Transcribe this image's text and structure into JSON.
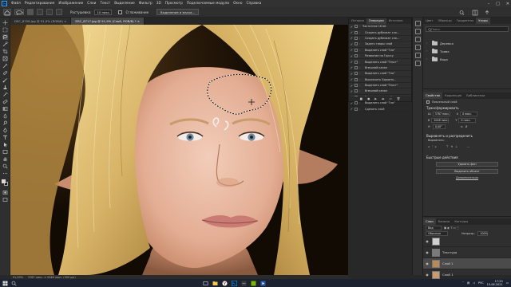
{
  "app": {
    "logo_text": "Ps"
  },
  "menubar": {
    "items": [
      "Файл",
      "Редактирование",
      "Изображение",
      "Слои",
      "Текст",
      "Выделение",
      "Фильтр",
      "3D",
      "Просмотр",
      "Подключаемые модули",
      "Окно",
      "Справка"
    ]
  },
  "options": {
    "feather_label": "Растушевка:",
    "feather_value": "10 пикс.",
    "antialias_label": "Сглаживание",
    "select_mask_button": "Выделение и маска..."
  },
  "tabs": [
    {
      "label": "DSC_8706.jpg @ 91,9% (RGB/8) ×",
      "active": false
    },
    {
      "label": "DSC_8717.jpg @ 91,9% (Слой, RGB/8) * ×",
      "active": true
    }
  ],
  "status": {
    "zoom": "91,59%",
    "doc_info": "3787 пикс. × 2048 пикс. (300 ppi)"
  },
  "history_panel": {
    "tabs": [
      "История",
      "Операции",
      "Источник"
    ],
    "active_tab": "Операции",
    "items": [
      {
        "label": "Частотное 16 bit",
        "checked": true,
        "folder": true
      },
      {
        "label": "Создать дубликат сло...",
        "checked": true,
        "folder": false
      },
      {
        "label": "Создать дубликат сло...",
        "checked": true,
        "folder": false
      },
      {
        "label": "Задать тиары слой",
        "checked": true,
        "folder": false
      },
      {
        "label": "Выделить слой \"Гло\"",
        "checked": true,
        "folder": false
      },
      {
        "label": "Размытие по Гауссу",
        "checked": true,
        "folder": false
      },
      {
        "label": "Выделить слой \"Текст\"",
        "checked": true,
        "folder": false
      },
      {
        "label": "Внешний канал",
        "checked": true,
        "folder": false
      },
      {
        "label": "Выделить слой \"Гло\"",
        "checked": true,
        "folder": false
      },
      {
        "label": "Выключить Удалить...",
        "checked": true,
        "folder": false
      },
      {
        "label": "Выделить слой \"Текст\"",
        "checked": true,
        "folder": false
      },
      {
        "label": "Внешний канал",
        "checked": true,
        "folder": false
      },
      {
        "label": "Задать тиары слой",
        "checked": true,
        "folder": false
      },
      {
        "label": "Выделить слой \"Гло\"",
        "checked": true,
        "folder": false
      },
      {
        "label": "Сделать слой",
        "checked": true,
        "folder": false
      }
    ],
    "footer_icons": [
      "■",
      "●",
      "▶",
      "▬",
      "▭",
      "🗑"
    ]
  },
  "right_top": {
    "tabs": [
      "Цвет",
      "Образцы",
      "Градиенты",
      "Узоры"
    ],
    "active_tab": "Узоры",
    "search_placeholder": "Поиск",
    "folders": [
      "Деревья",
      "Трава",
      "Вода"
    ]
  },
  "properties": {
    "tabs": [
      "Свойства",
      "Коррекция",
      "Библиотеки"
    ],
    "active_tab": "Свойства",
    "layer_type": "Пиксельный слой",
    "transform_title": "Трансформировать",
    "w_label": "Ш",
    "w_value": "3787 пикс.",
    "h_label": "В",
    "h_value": "2048 пикс.",
    "x_label": "X",
    "x_value": "0 пикс.",
    "y_label": "Y",
    "y_value": "0 пикс.",
    "angle_value": "0,00°",
    "align_title": "Выровнять и распределить",
    "align_sub": "Выровнять:",
    "quick_title": "Быстрые действия",
    "btn_remove_bg": "Удалить фон",
    "btn_select_subject": "Выделить объект",
    "more_link": "Дополнительно"
  },
  "layers_panel": {
    "tabs": [
      "Слои",
      "Каналы",
      "Контуры"
    ],
    "active_tab": "Слои",
    "kind_label": "Вид",
    "blend_mode": "Обычные",
    "opacity_label": "Непрозр.:",
    "opacity_value": "100%",
    "lock_label": "Закреп.:",
    "fill_label": "Заливка:",
    "fill_value": "100%",
    "layers": [
      {
        "name": "",
        "visible": true,
        "selected": false
      },
      {
        "name": "Текстура",
        "visible": true,
        "selected": false
      },
      {
        "name": "Слой 1",
        "visible": true,
        "selected": true
      },
      {
        "name": "Слой 1",
        "visible": true,
        "selected": false
      }
    ]
  },
  "taskbar": {
    "time": "17:20",
    "date": "15.06.2021",
    "lang": "РУС"
  },
  "colors": {
    "accent": "#31a8ff",
    "panel": "#2f2f2f",
    "canvas_bg": "#1a1208"
  }
}
